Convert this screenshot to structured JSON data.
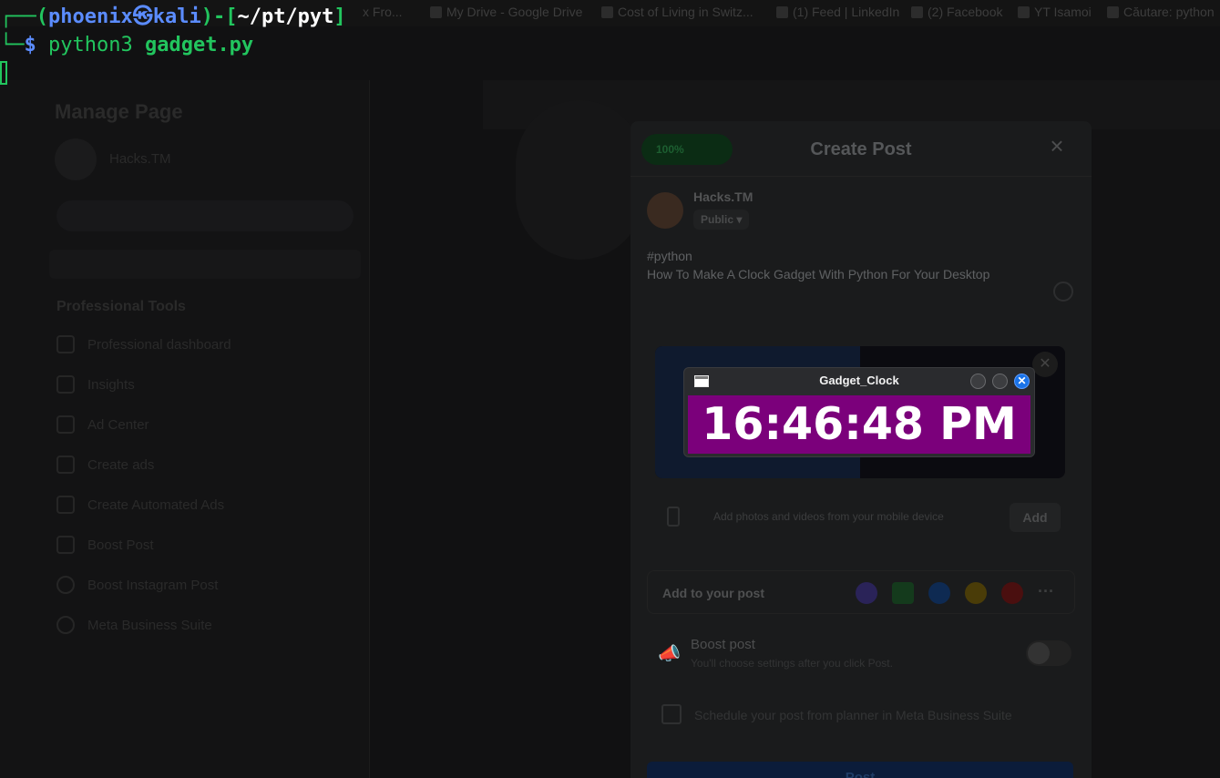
{
  "bookmarks": [
    {
      "label": "x Fro..."
    },
    {
      "label": "My Drive - Google Drive"
    },
    {
      "label": "Cost of Living in Switz..."
    },
    {
      "label": "(1) Feed | LinkedIn"
    },
    {
      "label": "(2) Facebook"
    },
    {
      "label": "YT Isamoi"
    },
    {
      "label": "Căutare: python"
    }
  ],
  "terminal": {
    "line1_open": "┌──(",
    "user": "phoenix",
    "sep": "㉿",
    "host": "kali",
    "mid": ")-[",
    "path": "~/pt/pyt",
    "line1_close": "]",
    "line2_prefix": "└─",
    "prompt": "$",
    "command": "python3",
    "arg": "gadget.py"
  },
  "left_nav": {
    "title": "Manage Page",
    "page_name": "Hacks.TM",
    "section": "Professional Tools",
    "items": [
      {
        "label": "Professional dashboard"
      },
      {
        "label": "Insights"
      },
      {
        "label": "Ad Center"
      },
      {
        "label": "Create ads"
      },
      {
        "label": "Create Automated Ads"
      },
      {
        "label": "Boost Post"
      },
      {
        "label": "Boost Instagram Post"
      },
      {
        "label": "Meta Business Suite"
      }
    ]
  },
  "create_post": {
    "badge": "100%",
    "title": "Create Post",
    "close": "×",
    "user_name": "Hacks.TM",
    "privacy": "Public ▾",
    "text_line1": "#python",
    "text_line2": "How To Make A Clock Gadget With Python For Your Desktop",
    "mobile_text": "Add photos and videos from your mobile device",
    "mobile_add": "Add",
    "add_to_post": "Add to your post",
    "boost_title": "Boost post",
    "boost_sub": "You'll choose settings after you click Post.",
    "schedule": "Schedule your post from planner in Meta Business Suite",
    "post_button": "Post",
    "media_close": "✕",
    "more": "···"
  },
  "gadget": {
    "window_title": "Gadget_Clock",
    "time": "16:46:48 PM",
    "close_glyph": "✕",
    "face_color": "#7b007b"
  }
}
